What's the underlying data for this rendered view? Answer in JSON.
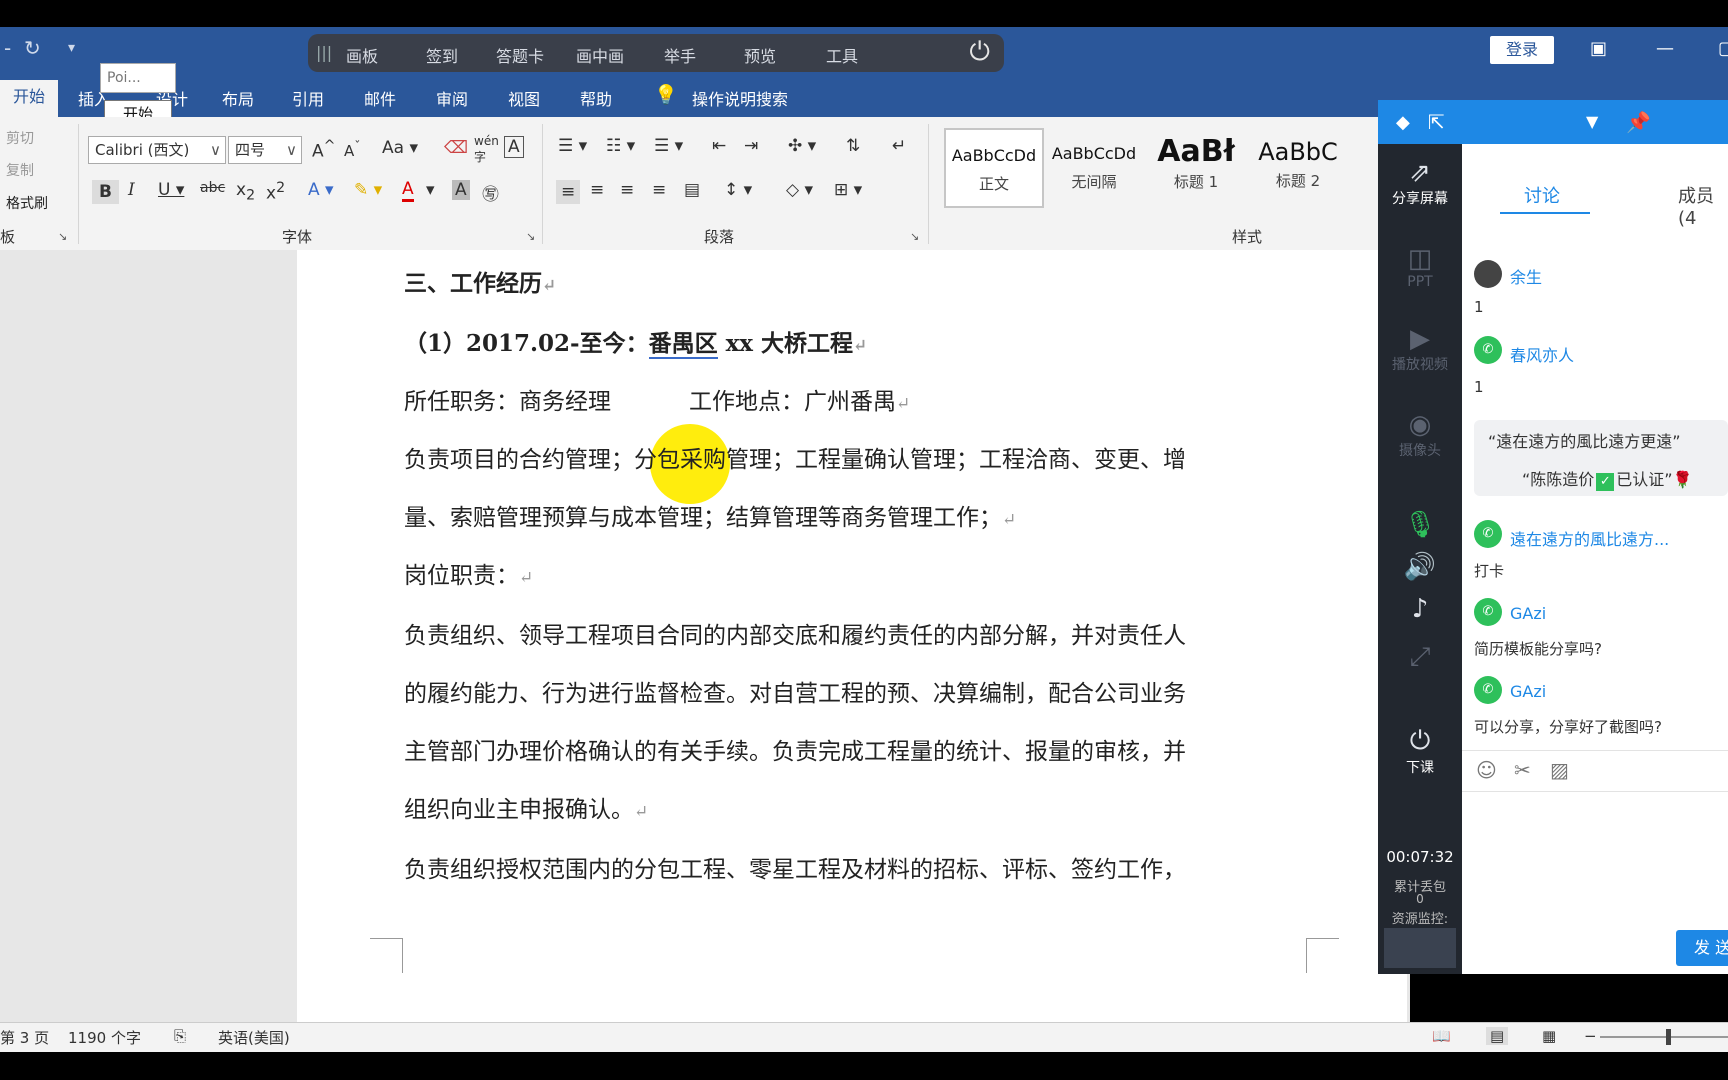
{
  "titlebar": {
    "classroom_tools": [
      "画板",
      "签到",
      "答题卡",
      "画中画",
      "举手",
      "预览",
      "工具"
    ],
    "login": "登录"
  },
  "ribbon": {
    "tabs": [
      "开始",
      "插入",
      "设计",
      "布局",
      "引用",
      "邮件",
      "审阅",
      "视图",
      "帮助"
    ],
    "tell_me": "操作说明搜索",
    "tooltip": "Poi...",
    "tooltip_button": "开始",
    "clipboard": {
      "cut": "剪切",
      "copy": "复制",
      "format_painter": "格式刷",
      "group": "板"
    },
    "font": {
      "name": "Calibri (西文)",
      "size": "四号",
      "aa": "Aa",
      "pinyin": "wén",
      "group": "字体"
    },
    "paragraph_group": "段落",
    "styles": {
      "items": [
        {
          "preview": "AaBbCcDd",
          "name": "正文"
        },
        {
          "preview": "AaBbCcDd",
          "name": "无间隔"
        },
        {
          "preview": "AaBł",
          "name": "标题 1"
        },
        {
          "preview": "AaBbC",
          "name": "标题 2"
        }
      ],
      "group": "样式"
    }
  },
  "document": {
    "heading": "三、工作经历",
    "entry_title_prefix": "（1）2017.02-至今：",
    "entry_title_place": "番禺区",
    "entry_title_rest": " xx 大桥工程",
    "position": "所任职务：商务经理",
    "location": "工作地点：广州番禺",
    "duty_line1": "负责项目的合约管理；分包采购管理；工程量确认管理；工程洽商、变更、增",
    "duty_line2": "量、索赔管理预算与成本管理；结算管理等商务管理工作；",
    "post_duty": "岗位职责：",
    "para_lines": [
      "负责组织、领导工程项目合同的内部交底和履约责任的内部分解，并对责任人",
      "的履约能力、行为进行监督检查。对自营工程的预、决算编制，配合公司业务",
      "主管部门办理价格确认的有关手续。负责完成工程量的统计、报量的审核，并",
      "组织向业主申报确认。"
    ],
    "last_line": "负责组织授权范围内的分包工程、零星工程及材料的招标、评标、签约工作，"
  },
  "status": {
    "page": "第 3 页",
    "words": "1190 个字",
    "language": "英语(美国)"
  },
  "panel": {
    "tabs": [
      "讨论",
      "成员(4"
    ],
    "tools": [
      "分享屏幕",
      "PPT",
      "播放视频",
      "摄像头",
      "下课"
    ],
    "timer": "00:07:32",
    "packet_loss_label": "累计丢包",
    "packet_loss_value": "0",
    "resource_label": "资源监控:",
    "messages": [
      {
        "name": "余生",
        "text": "1"
      },
      {
        "name": "春风亦人",
        "text": "1"
      },
      {
        "name": "遠在遠方的風比遠方...",
        "text": "打卡"
      },
      {
        "name": "GAzi",
        "text": "简历模板能分享吗?"
      },
      {
        "name": "GAzi",
        "text": "可以分享，分享好了截图吗?"
      }
    ],
    "quote_line1": "“遠在遠方的風比遠方更遠”",
    "quote_line2_a": "“陈陈造价",
    "quote_line2_b": "已认证”",
    "send": "发 送"
  }
}
